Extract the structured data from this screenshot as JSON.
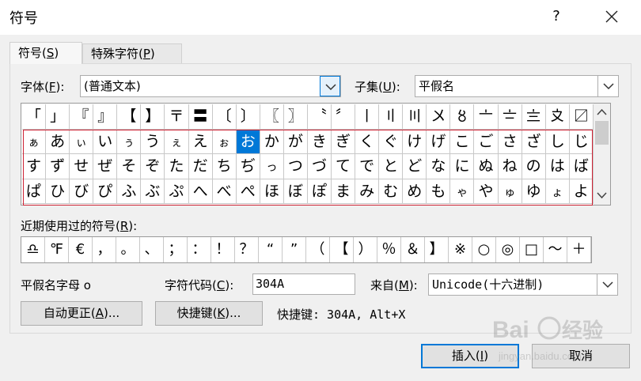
{
  "dialog": {
    "title": "符号",
    "help": "?"
  },
  "tabs": [
    {
      "label": "符号(",
      "key": "S",
      "suffix": ")"
    },
    {
      "label": "特殊字符(",
      "key": "P",
      "suffix": ")"
    }
  ],
  "font": {
    "label": "字体(",
    "key": "F",
    "suffix": "):",
    "value": "(普通文本)"
  },
  "subset": {
    "label": "子集(",
    "key": "U",
    "suffix": "):",
    "value": "平假名"
  },
  "symbol_rows": [
    [
      "「",
      "」",
      "『",
      "』",
      "【",
      "】",
      "〒",
      "〓",
      "〔",
      "〕",
      "〖",
      "〗",
      "〝",
      "〞",
      "〡",
      "〢",
      "〣",
      "〤",
      "〥",
      "〦",
      "〧",
      "〨",
      "〩",
      "〼"
    ],
    [
      "ぁ",
      "あ",
      "ぃ",
      "い",
      "ぅ",
      "う",
      "ぇ",
      "え",
      "ぉ",
      "お",
      "か",
      "が",
      "き",
      "ぎ",
      "く",
      "ぐ",
      "け",
      "げ",
      "こ",
      "ご",
      "さ",
      "ざ",
      "し",
      "じ"
    ],
    [
      "す",
      "ず",
      "せ",
      "ぜ",
      "そ",
      "ぞ",
      "た",
      "だ",
      "ち",
      "ぢ",
      "っ",
      "つ",
      "づ",
      "て",
      "で",
      "と",
      "ど",
      "な",
      "に",
      "ぬ",
      "ね",
      "の",
      "は",
      "ば"
    ],
    [
      "ぱ",
      "ひ",
      "び",
      "ぴ",
      "ふ",
      "ぶ",
      "ぷ",
      "へ",
      "べ",
      "ぺ",
      "ほ",
      "ぼ",
      "ぽ",
      "ま",
      "み",
      "む",
      "め",
      "も",
      "ゃ",
      "や",
      "ゅ",
      "ゆ",
      "ょ",
      "よ"
    ]
  ],
  "selected_symbol": "お",
  "recent": {
    "label": "近期使用过的符号(",
    "key": "R",
    "suffix": "):",
    "items": [
      "♎",
      "℉",
      "€",
      "，",
      "。",
      "、",
      "；",
      "：",
      "！",
      "？",
      "“",
      "”",
      "（",
      "【",
      "）",
      "％",
      "＆",
      "】",
      "※",
      "○",
      "◎",
      "□",
      "～",
      "＋"
    ]
  },
  "char_name": "平假名字母 o",
  "char_code": {
    "label": "字符代码(",
    "key": "C",
    "suffix": "):",
    "value": "304A"
  },
  "from": {
    "label": "来自(",
    "key": "M",
    "suffix": "):",
    "value": "Unicode(十六进制)"
  },
  "buttons": {
    "autocorrect": {
      "label": "自动更正(",
      "key": "A",
      "suffix": ")..."
    },
    "shortcut": {
      "label": "快捷键(",
      "key": "K",
      "suffix": ")..."
    },
    "insert": {
      "label": "插入(",
      "key": "I",
      "suffix": ")"
    },
    "cancel": {
      "label": "取消"
    }
  },
  "shortcut_info": "快捷键: 304A, Alt+X",
  "watermark": {
    "brand": "Bai",
    "suffix": "经验",
    "url": "jingyan.baidu.com"
  }
}
